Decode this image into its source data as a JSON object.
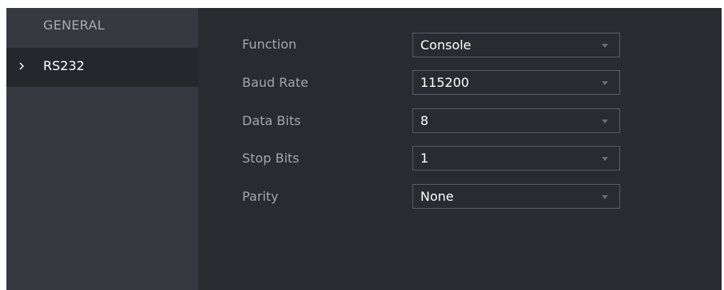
{
  "sidebar": {
    "items": [
      {
        "label": "GENERAL"
      },
      {
        "label": "RS232",
        "selected": true
      }
    ]
  },
  "form": {
    "fields": [
      {
        "label": "Function",
        "value": "Console"
      },
      {
        "label": "Baud Rate",
        "value": "115200"
      },
      {
        "label": "Data Bits",
        "value": "8"
      },
      {
        "label": "Stop Bits",
        "value": "1"
      },
      {
        "label": "Parity",
        "value": "None"
      }
    ]
  },
  "colors": {
    "panel_background": "#2a2b31",
    "sidebar_background": "#373840",
    "selected_item_background": "#26272d",
    "field_border": "#5a5b62",
    "label_text": "#a4a5ab",
    "value_text": "#ffffff"
  },
  "icons": {
    "selected_marker": "chevron-right-icon",
    "dropdown": "caret-down-icon"
  }
}
